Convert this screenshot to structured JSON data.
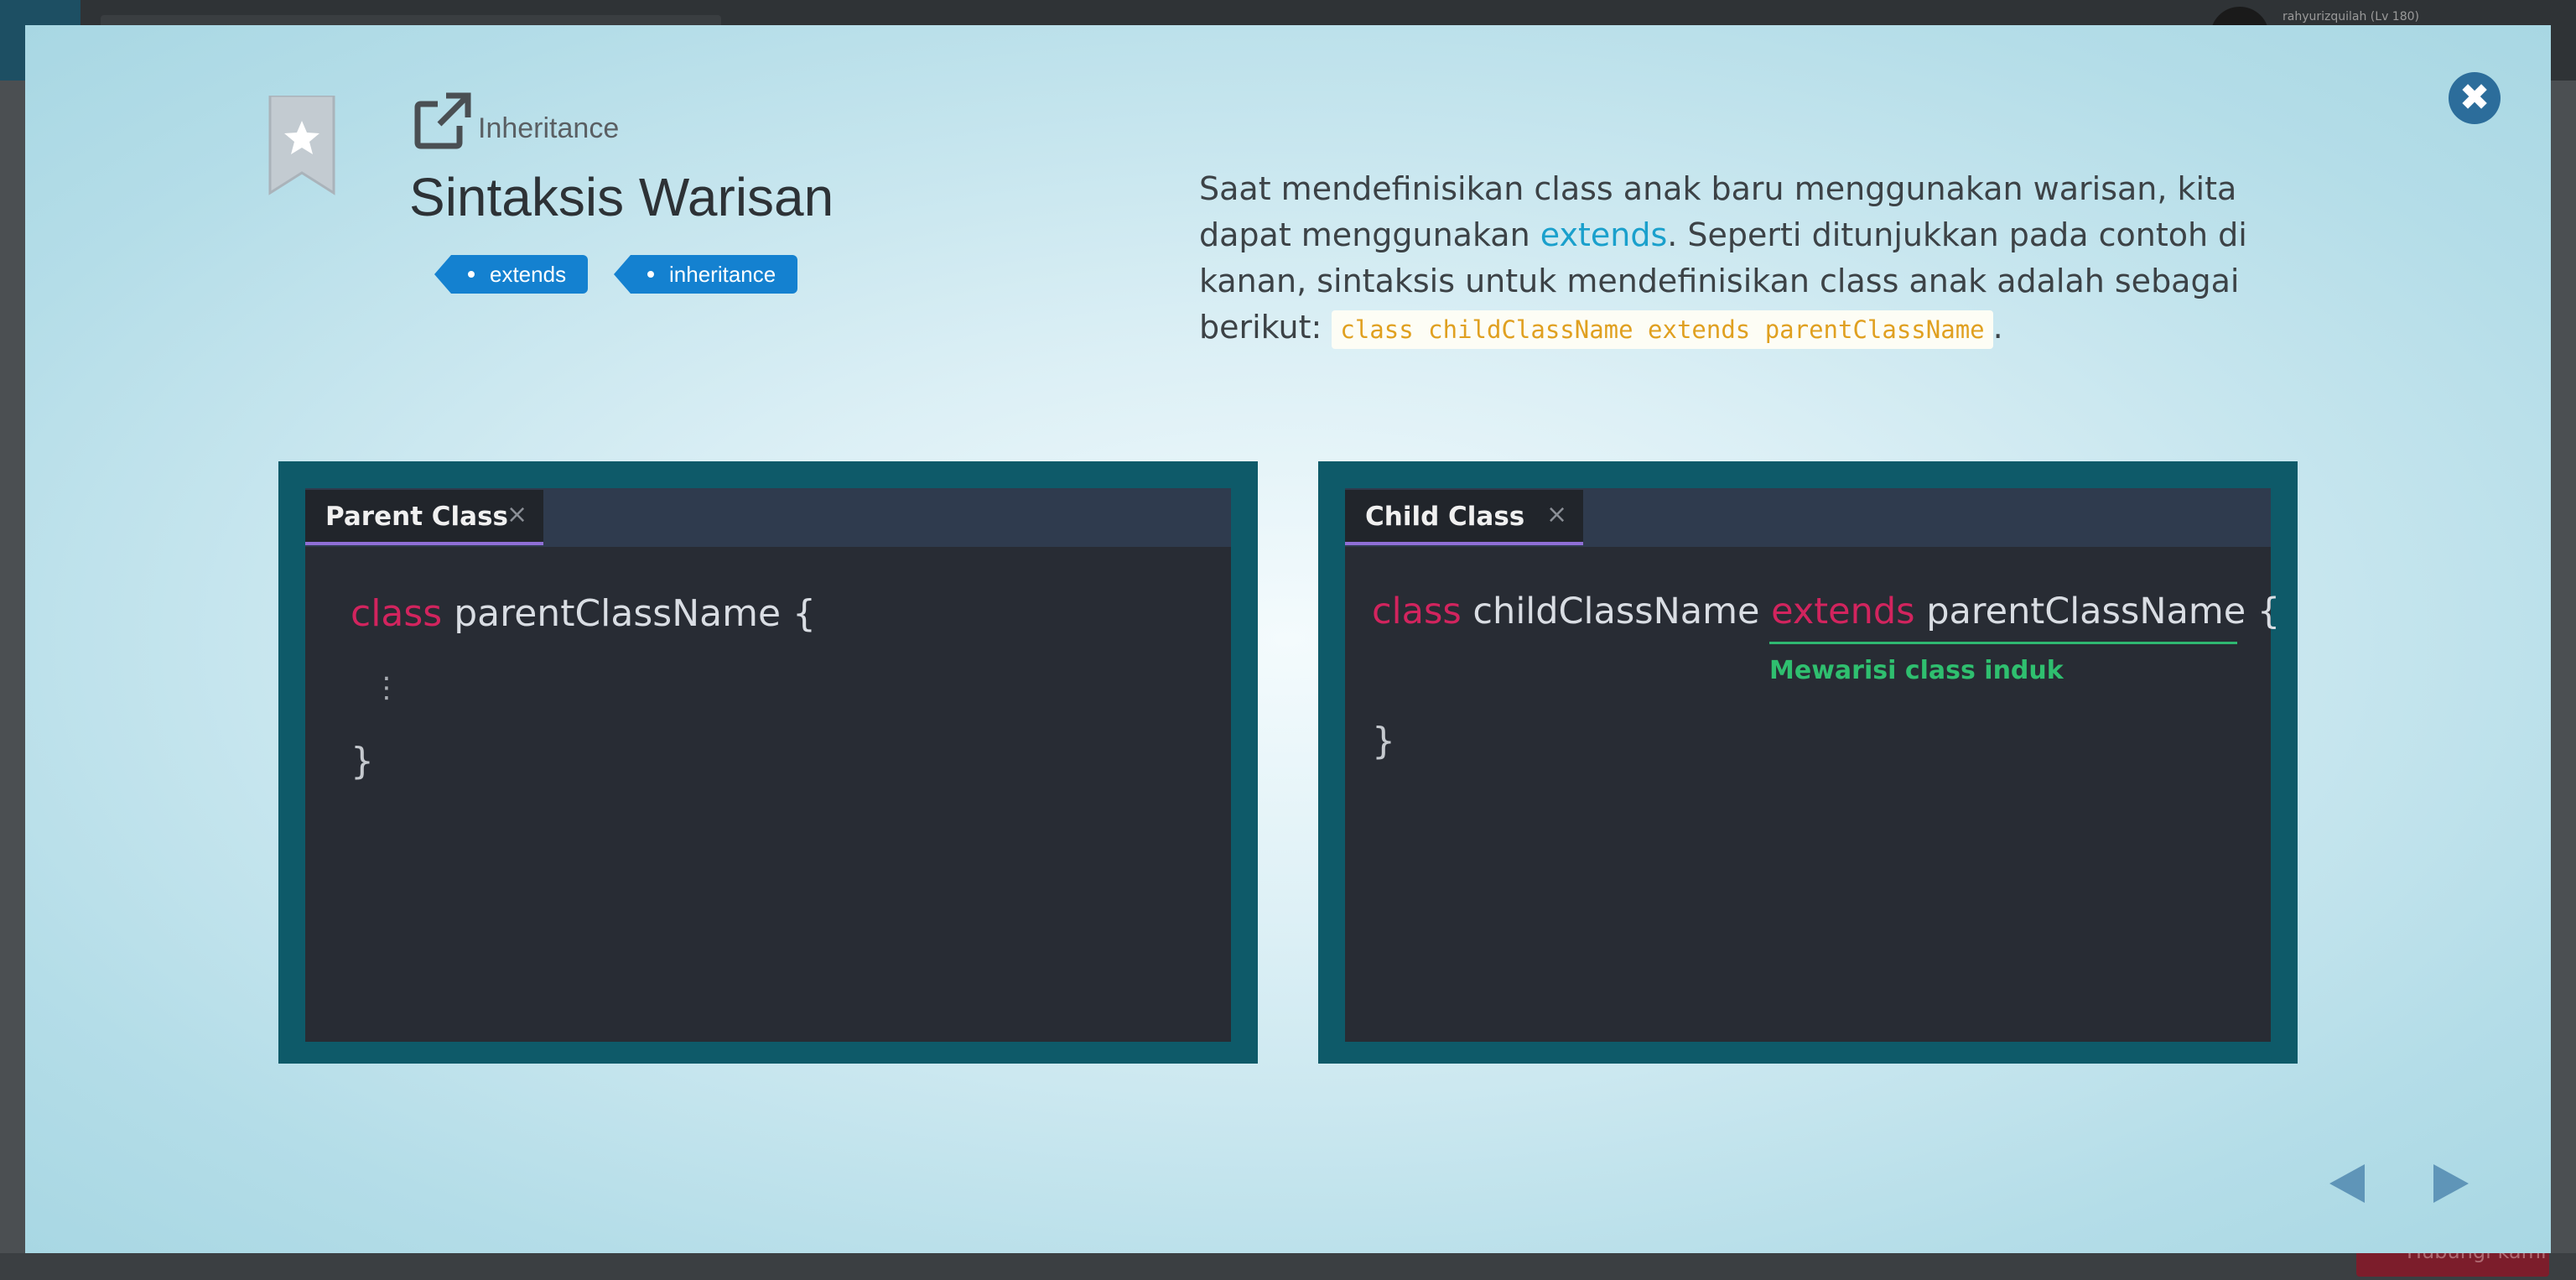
{
  "background": {
    "user_label": "rahyurizquilah (Lv 180)",
    "bottom_button_label": "Hubungi kami"
  },
  "header": {
    "breadcrumb": "Inheritance",
    "title": "Sintaksis Warisan",
    "tags": [
      "extends",
      "inheritance"
    ]
  },
  "description": {
    "part1": "Saat mendefinisikan class anak baru menggunakan warisan, kita dapat menggunakan ",
    "keyword": "extends",
    "part2": ". Seperti ditunjukkan pada contoh di kanan, sintaksis untuk mendefinisikan class anak adalah sebagai berikut: ",
    "code": "class childClassName extends parentClassName",
    "part3": "."
  },
  "parent_editor": {
    "tab_label": "Parent Class",
    "tab_close": "×",
    "keyword": "class",
    "name_text": " parentClassName {",
    "ellipsis": "⋮",
    "closing": "}"
  },
  "child_editor": {
    "tab_label": "Child Class",
    "tab_close": "×",
    "keyword": "class",
    "name_text": " childClassName ",
    "extends_kw": "extends",
    "parent_text": " parentClassName {",
    "annotation": "Mewarisi class induk",
    "closing": "}"
  },
  "controls": {
    "close_glyph": "✖",
    "prev_icon": "triangle-left-icon",
    "next_icon": "triangle-right-icon"
  },
  "colors": {
    "accent_blue": "#1481d0",
    "panel_teal": "#0e5a69",
    "keyword_red": "#d2245e",
    "annotation_green": "#2fbf6f"
  }
}
